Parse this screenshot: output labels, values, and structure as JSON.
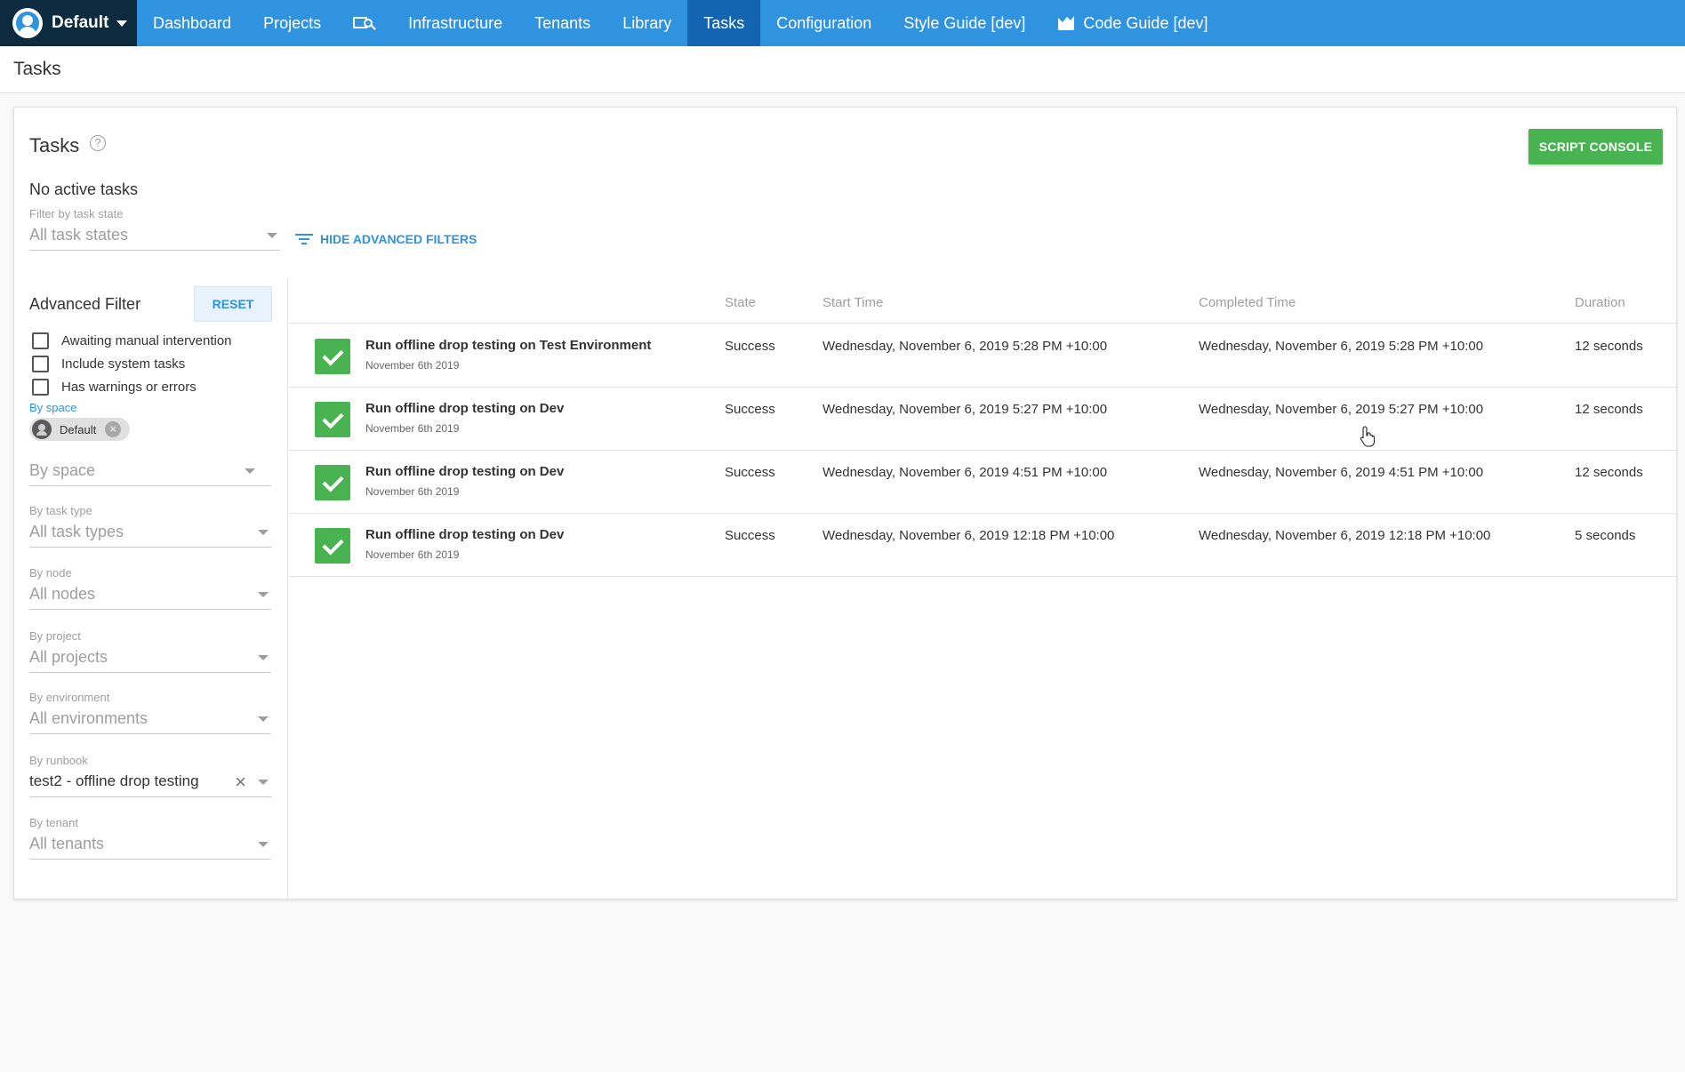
{
  "nav": {
    "space_name": "Default",
    "items": [
      {
        "label": "Dashboard"
      },
      {
        "label": "Projects"
      },
      {
        "label": ""
      },
      {
        "label": "Infrastructure"
      },
      {
        "label": "Tenants"
      },
      {
        "label": "Library"
      },
      {
        "label": "Tasks"
      },
      {
        "label": "Configuration"
      },
      {
        "label": "Style Guide [dev]"
      },
      {
        "label": "Code Guide [dev]"
      }
    ],
    "active": "Tasks"
  },
  "page": {
    "title": "Tasks"
  },
  "card": {
    "title": "Tasks",
    "help_symbol": "?",
    "script_console_label": "SCRIPT CONSOLE",
    "no_active_tasks": "No active tasks",
    "filter_state_label": "Filter by task state",
    "filter_state_value": "All task states",
    "hide_filters_label": "HIDE ADVANCED FILTERS"
  },
  "advanced": {
    "title": "Advanced Filter",
    "reset_label": "RESET",
    "checkboxes": [
      {
        "label": "Awaiting manual intervention"
      },
      {
        "label": "Include system tasks"
      },
      {
        "label": "Has warnings or errors"
      }
    ],
    "by_space_label": "By space",
    "space_chip": "Default",
    "space_chip_close": "×",
    "space_placeholder": "By space",
    "task_type_label": "By task type",
    "task_type_value": "All task types",
    "node_label": "By node",
    "node_value": "All nodes",
    "project_label": "By project",
    "project_value": "All projects",
    "environment_label": "By environment",
    "environment_value": "All environments",
    "runbook_label": "By runbook",
    "runbook_value": "test2 - offline drop testing",
    "runbook_clear": "×",
    "tenant_label": "By tenant",
    "tenant_value": "All tenants"
  },
  "table": {
    "headers": {
      "state": "State",
      "start": "Start Time",
      "completed": "Completed Time",
      "duration": "Duration"
    },
    "rows": [
      {
        "name": "Run offline drop testing on Test Environment",
        "date": "November 6th 2019",
        "state": "Success",
        "start": "Wednesday, November 6, 2019 5:28 PM +10:00",
        "completed": "Wednesday, November 6, 2019 5:28 PM +10:00",
        "duration": "12 seconds"
      },
      {
        "name": "Run offline drop testing on Dev",
        "date": "November 6th 2019",
        "state": "Success",
        "start": "Wednesday, November 6, 2019 5:27 PM +10:00",
        "completed": "Wednesday, November 6, 2019 5:27 PM +10:00",
        "duration": "12 seconds"
      },
      {
        "name": "Run offline drop testing on Dev",
        "date": "November 6th 2019",
        "state": "Success",
        "start": "Wednesday, November 6, 2019 4:51 PM +10:00",
        "completed": "Wednesday, November 6, 2019 4:51 PM +10:00",
        "duration": "12 seconds"
      },
      {
        "name": "Run offline drop testing on Dev",
        "date": "November 6th 2019",
        "state": "Success",
        "start": "Wednesday, November 6, 2019 12:18 PM +10:00",
        "completed": "Wednesday, November 6, 2019 12:18 PM +10:00",
        "duration": "5 seconds"
      }
    ]
  },
  "colors": {
    "nav_bg": "#2f93e0",
    "nav_active": "#1465b1",
    "space_switcher_bg": "#0d2b3e",
    "success": "#48b350",
    "link": "#2f93e0"
  },
  "icons": {
    "space_logo": "octopus-logo-icon",
    "nav_search": "search-window-icon",
    "code_guide": "chart-icon",
    "help": "help-circle-icon",
    "filter": "filter-icon",
    "status": "check-icon",
    "cursor": "hand-cursor-icon"
  }
}
